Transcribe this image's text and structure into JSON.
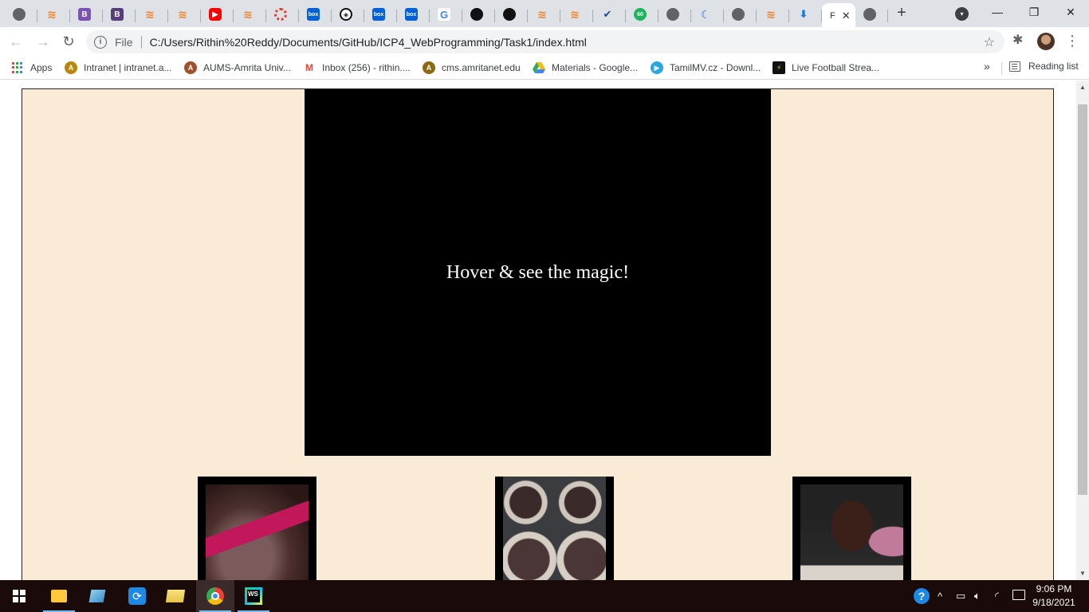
{
  "browser": {
    "active_tab_letter": "F",
    "omnibox": {
      "scheme": "File",
      "url": "C:/Users/Rithin%20Reddy/Documents/GitHub/ICP4_WebProgramming/Task1/index.html"
    },
    "bookmarks": [
      {
        "label": "Apps"
      },
      {
        "label": "Intranet | intranet.a..."
      },
      {
        "label": "AUMS-Amrita Univ..."
      },
      {
        "label": "Inbox (256) - rithin...."
      },
      {
        "label": "cms.amritanet.edu"
      },
      {
        "label": "Materials - Google..."
      },
      {
        "label": "TamilMV.cz - Downl..."
      },
      {
        "label": "Live Football Strea..."
      }
    ],
    "reading_list_label": "Reading list"
  },
  "page": {
    "hero_text": "Hover & see the magic!",
    "background_color": "#faebd7",
    "thumbnails": [
      {
        "name": "batter"
      },
      {
        "name": "tray"
      },
      {
        "name": "cupcake"
      }
    ]
  },
  "taskbar": {
    "time": "9:06 PM",
    "date": "9/18/2021"
  }
}
